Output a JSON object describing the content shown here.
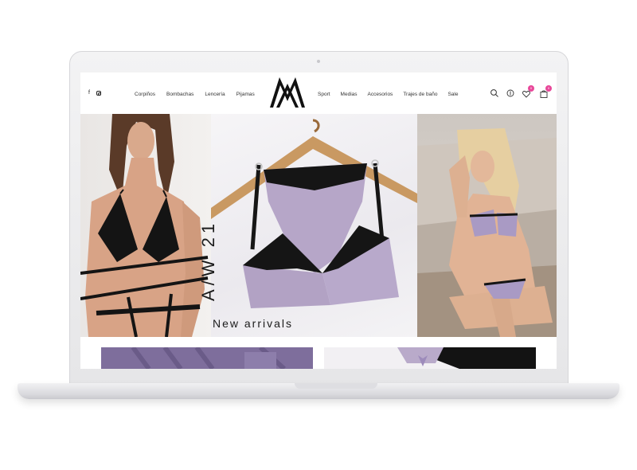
{
  "header": {
    "social": [
      "f"
    ],
    "nav_left": [
      "Corpiños",
      "Bombachas",
      "Lencería",
      "Pijamas"
    ],
    "nav_right": [
      "Sport",
      "Medias",
      "Accesorios",
      "Trajes de baño",
      "Sale"
    ],
    "icons": [
      "search-icon",
      "account-icon",
      "wishlist-icon",
      "cart-icon"
    ],
    "wishlist_count": "0",
    "cart_count": "0"
  },
  "hero": {
    "vertical_text": "A/W 21",
    "caption": "New arrivals"
  },
  "colors": {
    "accent": "#e8489a",
    "lavender": "#b8a9c9",
    "lace": "#151515"
  }
}
